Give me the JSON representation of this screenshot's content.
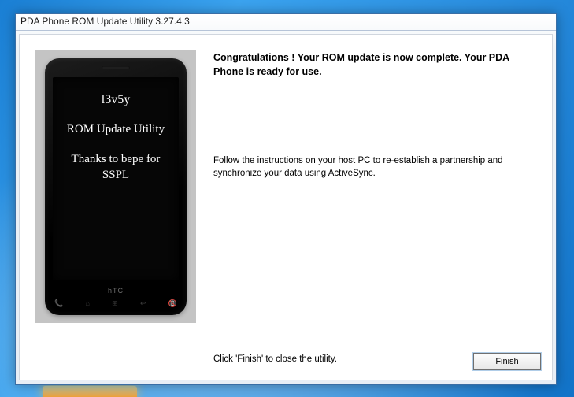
{
  "window": {
    "title": "PDA Phone ROM Update Utility 3.27.4.3"
  },
  "phone": {
    "line1": "l3v5y",
    "line2": "ROM Update Utility",
    "line3a": "Thanks to bepe for",
    "line3b": "SSPL",
    "brand": "hTC"
  },
  "content": {
    "headline": "Congratulations ! Your ROM update is now complete. Your PDA Phone is ready for use.",
    "body": "Follow the instructions on your host PC to re-establish a partnership and synchronize your data using ActiveSync.",
    "hint": "Click 'Finish' to close the utility."
  },
  "buttons": {
    "finish": "Finish"
  }
}
